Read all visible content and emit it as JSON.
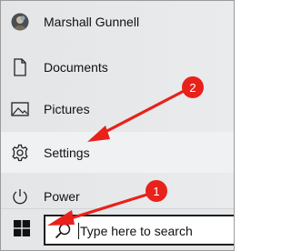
{
  "start_menu": {
    "items": [
      {
        "label": "Marshall Gunnell",
        "icon": "user-avatar-icon"
      },
      {
        "label": "Documents",
        "icon": "document-icon"
      },
      {
        "label": "Pictures",
        "icon": "pictures-icon"
      },
      {
        "label": "Settings",
        "icon": "gear-icon"
      },
      {
        "label": "Power",
        "icon": "power-icon"
      }
    ]
  },
  "taskbar": {
    "start_icon": "windows-logo-icon",
    "search": {
      "placeholder": "Type here to search",
      "icon": "search-icon"
    }
  },
  "annotations": [
    {
      "number": "1",
      "points_to": "Start button",
      "color": "#e8211b"
    },
    {
      "number": "2",
      "points_to": "Settings",
      "color": "#e8211b"
    }
  ]
}
